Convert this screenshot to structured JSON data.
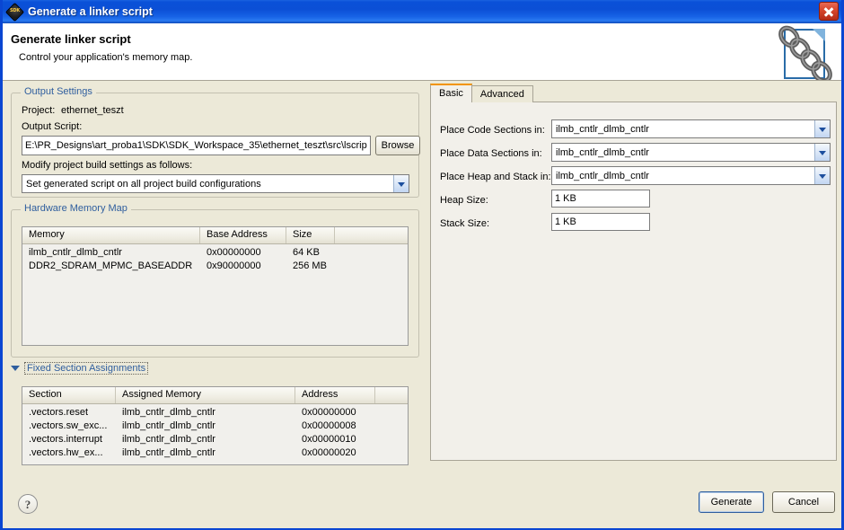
{
  "window": {
    "title": "Generate a linker script",
    "icon": "sdk-icon",
    "close_label": "✕"
  },
  "header": {
    "title": "Generate linker script",
    "subtitle": "Control your application's memory map.",
    "icon": "linker-script-document-chain-icon"
  },
  "left": {
    "output_settings": {
      "group_title": "Output Settings",
      "project_label": "Project:",
      "project_value": "ethernet_teszt",
      "output_script_label": "Output Script:",
      "output_script_value": "E:\\PR_Designs\\art_proba1\\SDK\\SDK_Workspace_35\\ethernet_teszt\\src\\lscrip",
      "browse_label": "Browse",
      "modify_label": "Modify project build settings as follows:",
      "modify_value": "Set generated script on all project build configurations",
      "modify_options": [
        "Set generated script on all project build configurations"
      ]
    },
    "hardware_memory_map": {
      "group_title": "Hardware Memory Map",
      "columns": [
        "Memory",
        "Base Address",
        "Size",
        ""
      ],
      "rows": [
        [
          "ilmb_cntlr_dlmb_cntlr",
          "0x00000000",
          "64 KB",
          ""
        ],
        [
          "DDR2_SDRAM_MPMC_BASEADDR",
          "0x90000000",
          "256 MB",
          ""
        ]
      ]
    },
    "fixed_sections": {
      "title": "Fixed Section Assignments",
      "expanded": true,
      "columns": [
        "Section",
        "Assigned Memory",
        "Address",
        ""
      ],
      "rows": [
        [
          ".vectors.reset",
          "ilmb_cntlr_dlmb_cntlr",
          "0x00000000",
          ""
        ],
        [
          ".vectors.sw_exc...",
          "ilmb_cntlr_dlmb_cntlr",
          "0x00000008",
          ""
        ],
        [
          ".vectors.interrupt",
          "ilmb_cntlr_dlmb_cntlr",
          "0x00000010",
          ""
        ],
        [
          ".vectors.hw_ex...",
          "ilmb_cntlr_dlmb_cntlr",
          "0x00000020",
          ""
        ]
      ]
    }
  },
  "right": {
    "tabs": [
      {
        "label": "Basic",
        "selected": true
      },
      {
        "label": "Advanced",
        "selected": false
      }
    ],
    "fields": {
      "code_sections_label": "Place Code Sections in:",
      "code_sections_value": "ilmb_cntlr_dlmb_cntlr",
      "data_sections_label": "Place Data Sections in:",
      "data_sections_value": "ilmb_cntlr_dlmb_cntlr",
      "heap_stack_label": "Place Heap and Stack in:",
      "heap_stack_value": "ilmb_cntlr_dlmb_cntlr",
      "heap_size_label": "Heap Size:",
      "heap_size_value": "1 KB",
      "stack_size_label": "Stack Size:",
      "stack_size_value": "1 KB",
      "memory_options": [
        "ilmb_cntlr_dlmb_cntlr",
        "DDR2_SDRAM_MPMC_BASEADDR"
      ]
    }
  },
  "footer": {
    "help_label": "?",
    "generate_label": "Generate",
    "cancel_label": "Cancel"
  },
  "colors": {
    "titlebar_blue": "#0a51d8",
    "dialog_bg": "#ece9d8",
    "group_title_blue": "#2f5e9e",
    "selected_tab_accent": "#f29400",
    "close_red": "#d6452c"
  }
}
